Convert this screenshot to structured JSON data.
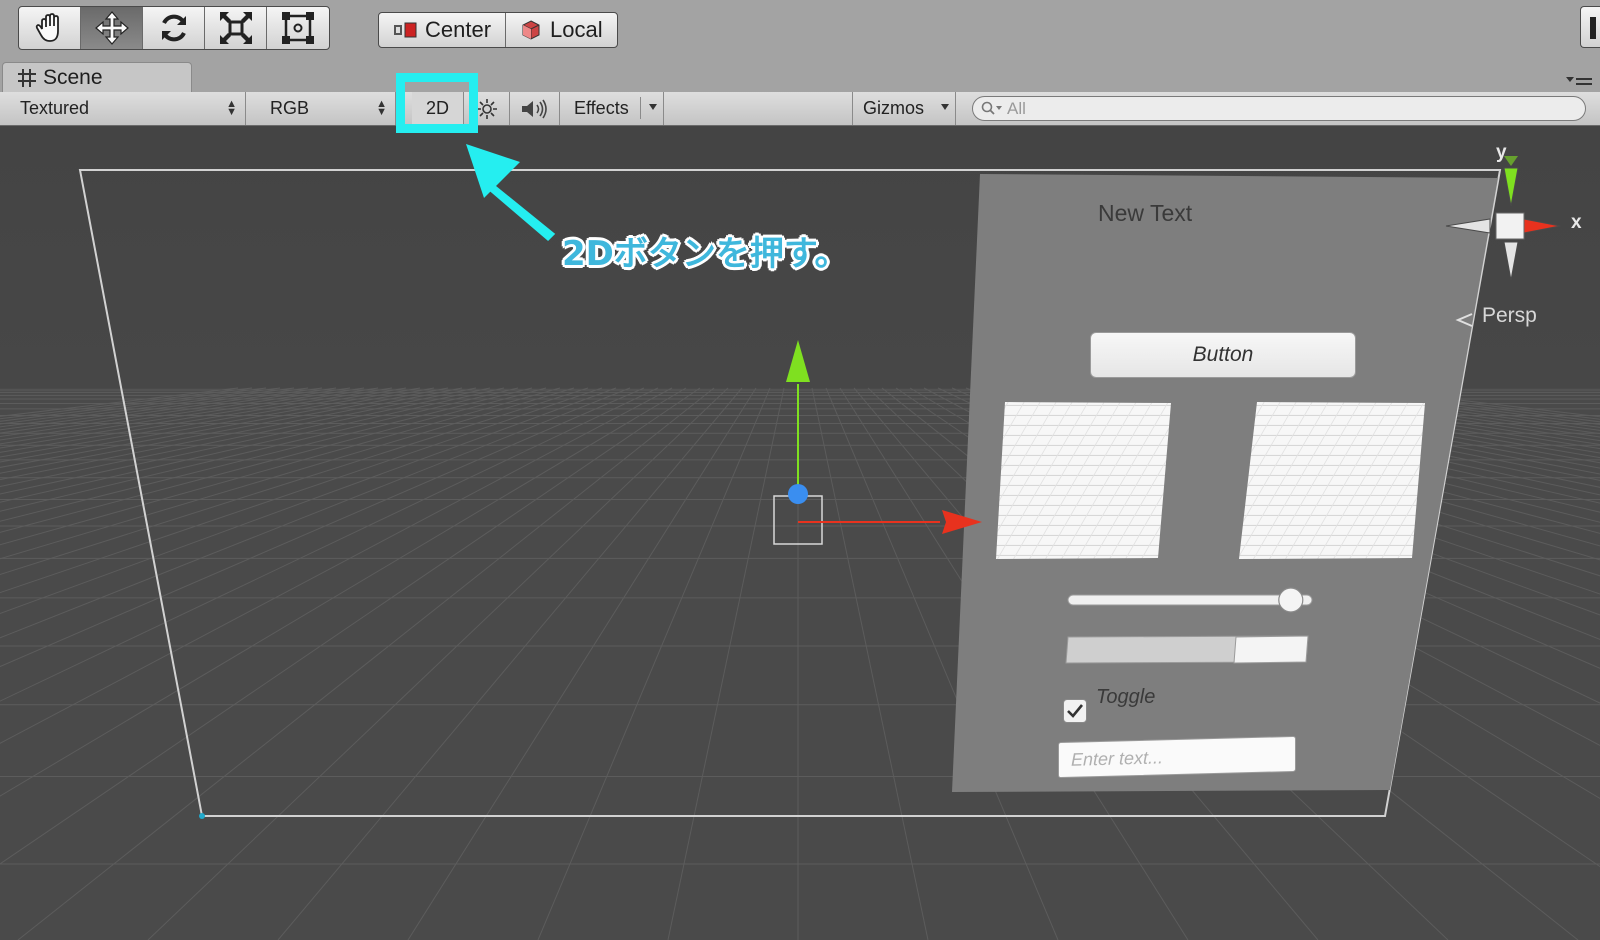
{
  "toolbar": {
    "transform_tools": [
      {
        "name": "hand-tool-button",
        "icon": "hand-icon"
      },
      {
        "name": "move-tool-button",
        "icon": "move-arrows-icon",
        "active": true
      },
      {
        "name": "rotate-tool-button",
        "icon": "rotate-icon"
      },
      {
        "name": "scale-tool-button",
        "icon": "scale-icon"
      },
      {
        "name": "rect-tool-button",
        "icon": "rect-transform-icon"
      }
    ],
    "pivot_label": "Center",
    "pivot_icon": "pivot-center-icon",
    "space_label": "Local",
    "space_icon": "local-cube-icon"
  },
  "scene_tab": {
    "label": "Scene",
    "icon": "grid-hash-icon"
  },
  "scene_toolbar": {
    "draw_mode": "Textured",
    "render_mode": "RGB",
    "mode_2d": "2D",
    "lighting_icon": "sun-icon",
    "audio_icon": "speaker-icon",
    "effects_label": "Effects",
    "gizmos_label": "Gizmos",
    "search_placeholder": "All",
    "search_icon": "search-icon"
  },
  "scene_gizmo": {
    "y_label": "y",
    "x_label": "x",
    "projection_label": "Persp"
  },
  "canvas_ui": {
    "text_label": "New Text",
    "button_label": "Button",
    "toggle_label": "Toggle",
    "toggle_checked": true,
    "input_placeholder": "Enter text...",
    "slider_value": 0.95,
    "scrollbar_value": 0.7
  },
  "annotation": {
    "callout_text": "2Dボタンを押す。",
    "highlight_color": "#25eef0",
    "callout_color": "#3fb7dc"
  },
  "colors": {
    "axis_y": "#7fe020",
    "axis_x": "#e8321e",
    "handle_center": "#3a8ef0",
    "viewport_bg": "#444444"
  }
}
